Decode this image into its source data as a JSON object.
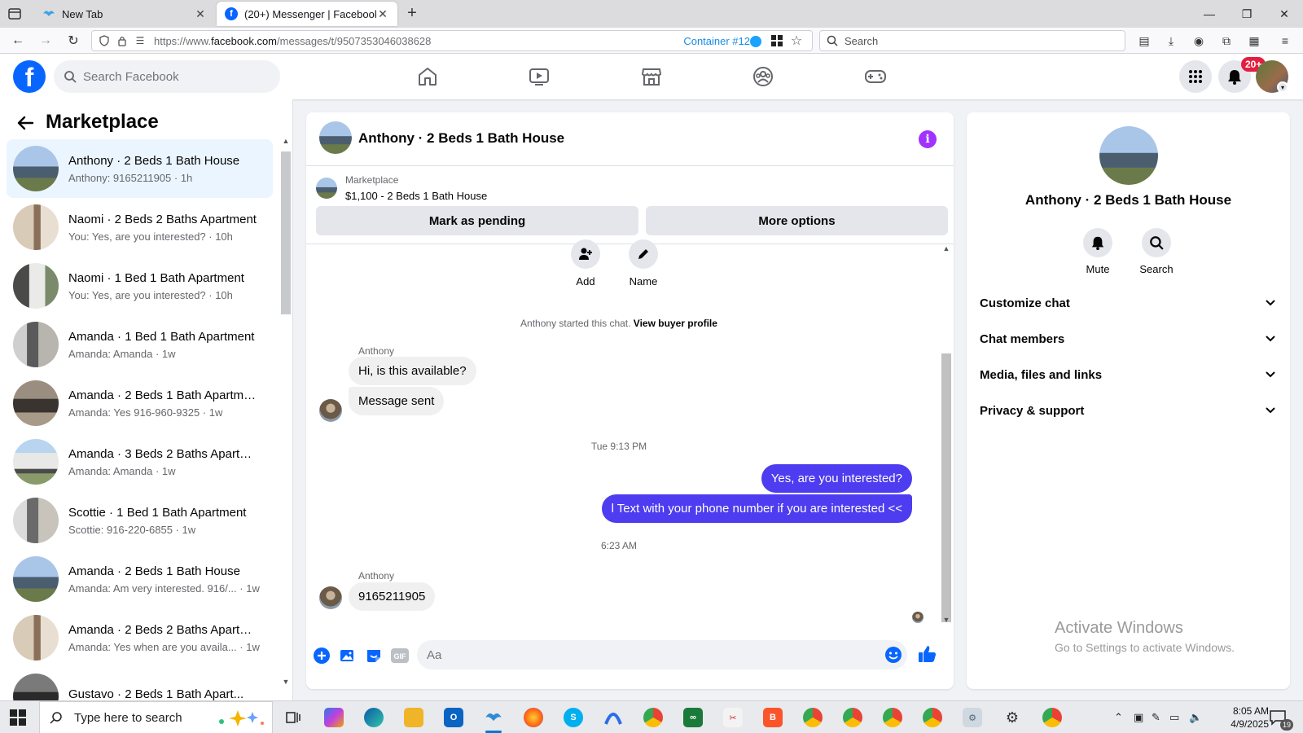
{
  "browser": {
    "tabs": [
      {
        "title": "New Tab",
        "active": false
      },
      {
        "title": "(20+) Messenger | Facebook",
        "active": true
      }
    ],
    "url_prefix": "https://www.",
    "url_domain": "facebook.com",
    "url_path": "/messages/t/9507353046038628",
    "container_label": "Container #12",
    "search_placeholder": "Search"
  },
  "fb_header": {
    "logo_letter": "f",
    "search_placeholder": "Search Facebook",
    "notification_badge": "20+"
  },
  "sidebar": {
    "title": "Marketplace",
    "conversations": [
      {
        "name": "Anthony · 2 Beds 1 Bath House",
        "preview": "Anthony: 9165211905 · 1h",
        "selected": true
      },
      {
        "name": "Naomi · 2 Beds 2 Baths Apartment",
        "preview": "You: Yes, are you interested? · 10h"
      },
      {
        "name": "Naomi · 1 Bed 1 Bath Apartment",
        "preview": "You: Yes, are you interested? · 10h"
      },
      {
        "name": "Amanda · 1 Bed 1 Bath Apartment",
        "preview": "Amanda: Amanda · 1w"
      },
      {
        "name": "Amanda · 2 Beds 1 Bath Apartme...",
        "preview": "Amanda: Yes 916-960-9325 · 1w"
      },
      {
        "name": "Amanda · 3 Beds 2 Baths Apartm...",
        "preview": "Amanda: Amanda · 1w"
      },
      {
        "name": "Scottie · 1 Bed 1 Bath Apartment",
        "preview": "Scottie: 916-220-6855 · 1w"
      },
      {
        "name": "Amanda · 2 Beds 1 Bath House",
        "preview": "Amanda: Am very interested. 916/... · 1w"
      },
      {
        "name": "Amanda · 2 Beds 2 Baths Apartm...",
        "preview": "Amanda: Yes when are you availa... · 1w"
      },
      {
        "name": "Gustavo · 2 Beds 1 Bath Apart...",
        "preview": ""
      }
    ]
  },
  "chat": {
    "title": "Anthony · 2 Beds 1 Bath House",
    "listing_source": "Marketplace",
    "listing_price": "$1,100 - 2 Beds 1 Bath House",
    "mark_pending_label": "Mark as pending",
    "more_options_label": "More options",
    "add_label": "Add",
    "name_label": "Name",
    "started_text": "Anthony started this chat. ",
    "view_buyer_label": "View buyer profile",
    "sender_1": "Anthony",
    "msg_1": "Hi, is this available?",
    "msg_2": "Message sent",
    "time_1": "Tue 9:13 PM",
    "msg_3": "Yes, are you interested?",
    "msg_4": "l  Text with your phone number if you are interested <<",
    "time_2": "6:23 AM",
    "sender_2": "Anthony",
    "msg_5": "9165211905",
    "composer_placeholder": "Aa"
  },
  "info_panel": {
    "title": "Anthony · 2 Beds 1 Bath House",
    "mute_label": "Mute",
    "search_label": "Search",
    "sections": [
      "Customize chat",
      "Chat members",
      "Media, files and links",
      "Privacy & support"
    ],
    "watermark_1": "Activate Windows",
    "watermark_2": "Go to Settings to activate Windows."
  },
  "taskbar": {
    "search_placeholder": "Type here to search",
    "time": "8:05 AM",
    "date": "4/9/2025",
    "notification_count": "19"
  },
  "colors": {
    "fb_blue": "#0866ff",
    "outgoing_bubble": "#4e3cf0",
    "selected_row": "#ebf5ff",
    "info_purple": "#a033ff",
    "badge_red": "#e41e3f"
  }
}
